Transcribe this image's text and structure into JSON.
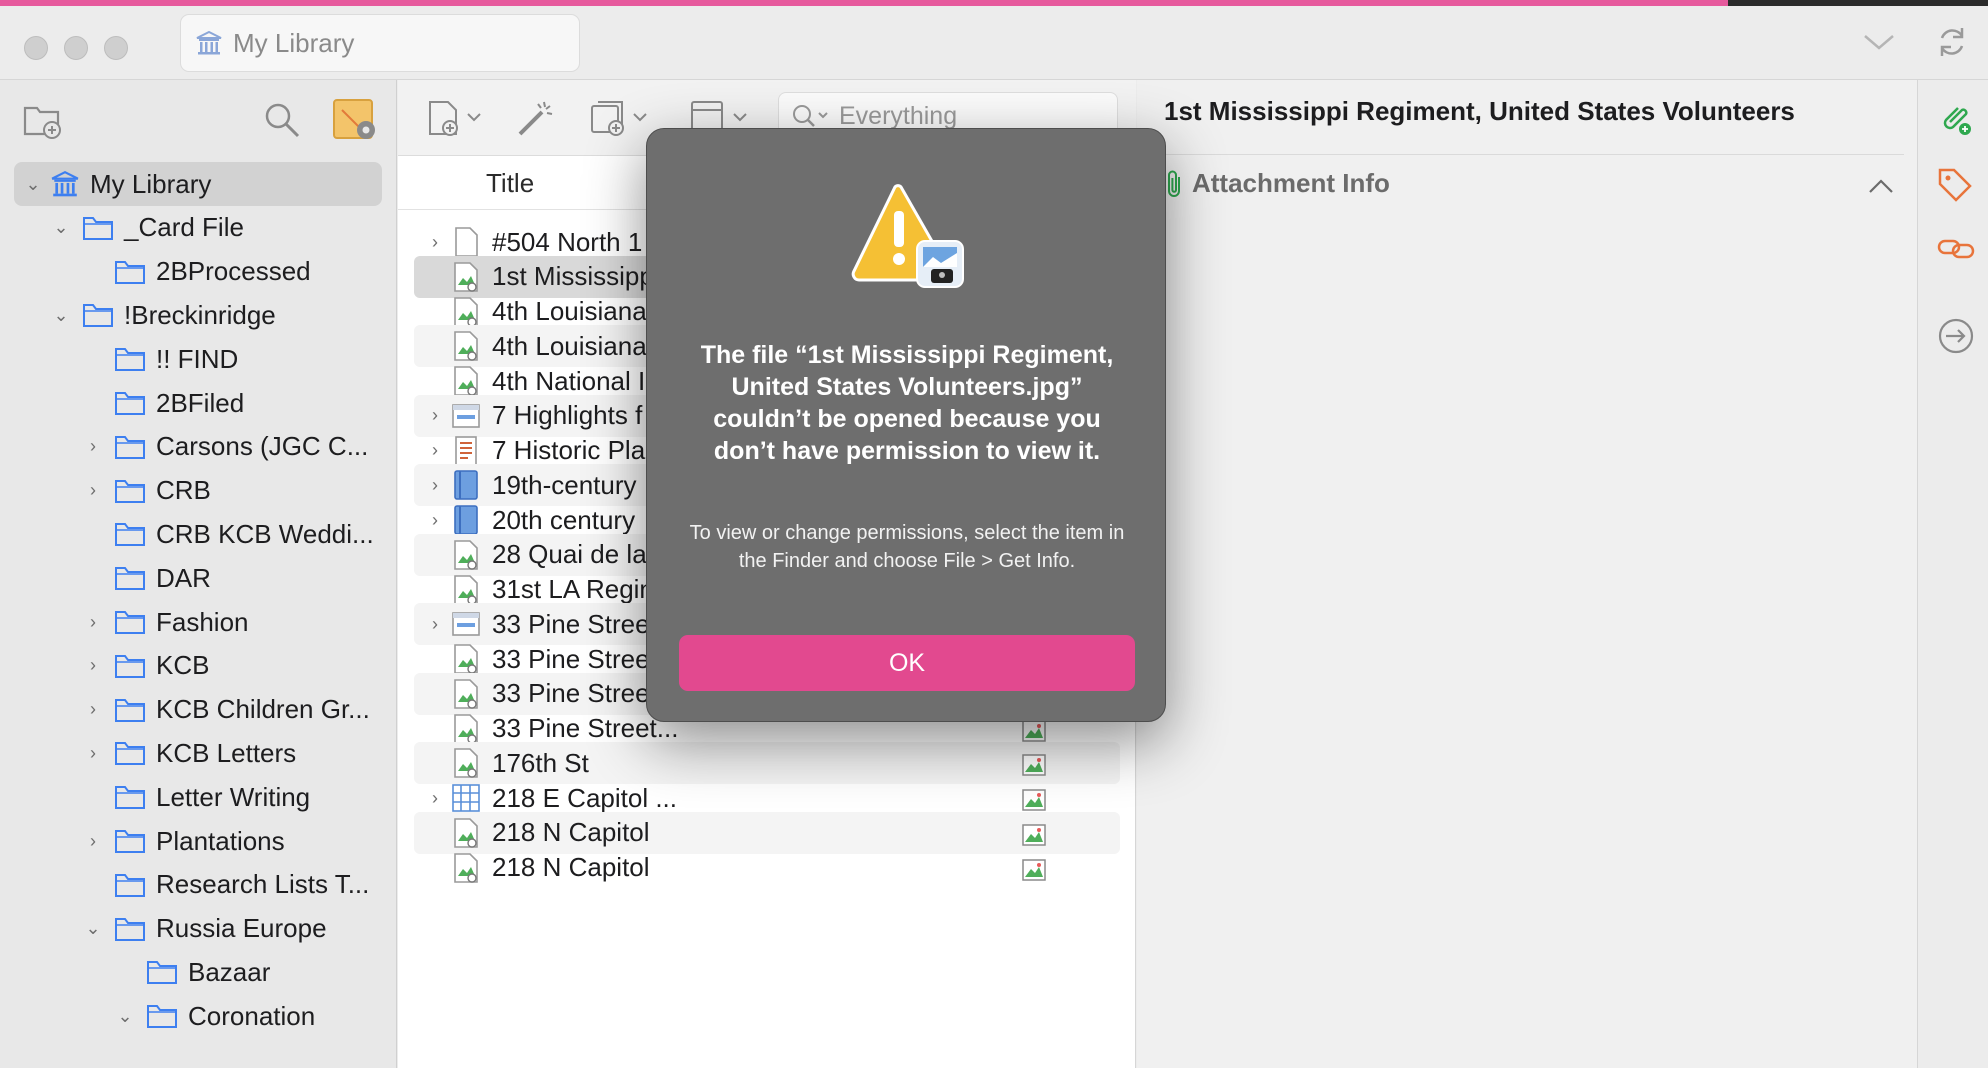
{
  "window": {
    "library_pill": "My Library"
  },
  "sidebar": {
    "items": [
      {
        "label": "My Library",
        "type": "library",
        "disc": "open",
        "selected": true
      },
      {
        "label": "_Card File",
        "type": "folder",
        "disc": "open"
      },
      {
        "label": "2BProcessed",
        "type": "folder",
        "disc": "none"
      },
      {
        "label": "!Breckinridge",
        "type": "folder",
        "disc": "open"
      },
      {
        "label": "!! FIND",
        "type": "folder",
        "disc": "none"
      },
      {
        "label": "2BFiled",
        "type": "folder",
        "disc": "none"
      },
      {
        "label": "Carsons (JGC C...",
        "type": "folder",
        "disc": "closed"
      },
      {
        "label": "CRB",
        "type": "folder",
        "disc": "closed"
      },
      {
        "label": "CRB KCB Weddi...",
        "type": "folder",
        "disc": "none"
      },
      {
        "label": "DAR",
        "type": "folder",
        "disc": "none"
      },
      {
        "label": "Fashion",
        "type": "folder",
        "disc": "closed"
      },
      {
        "label": "KCB",
        "type": "folder",
        "disc": "closed"
      },
      {
        "label": "KCB Children Gr...",
        "type": "folder",
        "disc": "closed"
      },
      {
        "label": "KCB Letters",
        "type": "folder",
        "disc": "closed"
      },
      {
        "label": "Letter Writing",
        "type": "folder",
        "disc": "none"
      },
      {
        "label": "Plantations",
        "type": "folder",
        "disc": "closed"
      },
      {
        "label": "Research Lists T...",
        "type": "folder",
        "disc": "none"
      },
      {
        "label": "Russia Europe",
        "type": "folder",
        "disc": "open"
      },
      {
        "label": "Bazaar",
        "type": "folder",
        "disc": "none"
      },
      {
        "label": "Coronation",
        "type": "folder",
        "disc": "open"
      }
    ]
  },
  "items_pane": {
    "search_placeholder": "Everything",
    "column_title": "Title",
    "rows": [
      {
        "title": "#504 North 1",
        "icon": "document",
        "disc": "closed",
        "attachment": false
      },
      {
        "title": "1st Mississipp",
        "icon": "image",
        "disc": "none",
        "attachment": false,
        "selected": true
      },
      {
        "title": "4th Louisiana",
        "icon": "image",
        "disc": "none",
        "attachment": false
      },
      {
        "title": "4th Louisiana",
        "icon": "image",
        "disc": "none",
        "attachment": false
      },
      {
        "title": "4th National I",
        "icon": "image",
        "disc": "none",
        "attachment": false
      },
      {
        "title": "7 Highlights f",
        "icon": "webpage",
        "disc": "closed",
        "attachment": false
      },
      {
        "title": "7 Historic Pla",
        "icon": "report",
        "disc": "closed",
        "attachment": false
      },
      {
        "title": "19th-century",
        "icon": "book",
        "disc": "closed",
        "attachment": false
      },
      {
        "title": "20th century",
        "icon": "book",
        "disc": "closed",
        "attachment": false
      },
      {
        "title": "28 Quai de la",
        "icon": "image",
        "disc": "none",
        "attachment": false
      },
      {
        "title": "31st LA Regin",
        "icon": "image",
        "disc": "none",
        "attachment": false
      },
      {
        "title": "33 Pine Street...",
        "icon": "webpage",
        "disc": "closed",
        "attachment": true
      },
      {
        "title": "33 Pine Street...",
        "icon": "image",
        "disc": "none",
        "attachment": true
      },
      {
        "title": "33 Pine Street...",
        "icon": "image",
        "disc": "none",
        "attachment": true
      },
      {
        "title": "33 Pine Street...",
        "icon": "image",
        "disc": "none",
        "attachment": true
      },
      {
        "title": "176th St",
        "icon": "image",
        "disc": "none",
        "attachment": true
      },
      {
        "title": "218 E Capitol ...",
        "icon": "table",
        "disc": "closed",
        "attachment": true
      },
      {
        "title": "218 N Capitol",
        "icon": "image",
        "disc": "none",
        "attachment": true
      },
      {
        "title": "218 N Capitol",
        "icon": "image",
        "disc": "none",
        "attachment": true
      }
    ]
  },
  "item_pane": {
    "title": "1st Mississippi Regiment, United States Volunteers",
    "section": "Attachment Info"
  },
  "dialog": {
    "title": "The file “1st Mississippi Regiment, United States Volunteers.jpg” couldn’t be opened because you don’t have permission to view it.",
    "body": "To view or change permissions, select the item in the Finder and choose File > Get Info.",
    "ok_label": "OK"
  },
  "colors": {
    "accent_pink": "#e2498f",
    "folder_blue": "#3d8bff",
    "tag_orange": "#e8743b",
    "attach_green": "#2fa84f"
  }
}
